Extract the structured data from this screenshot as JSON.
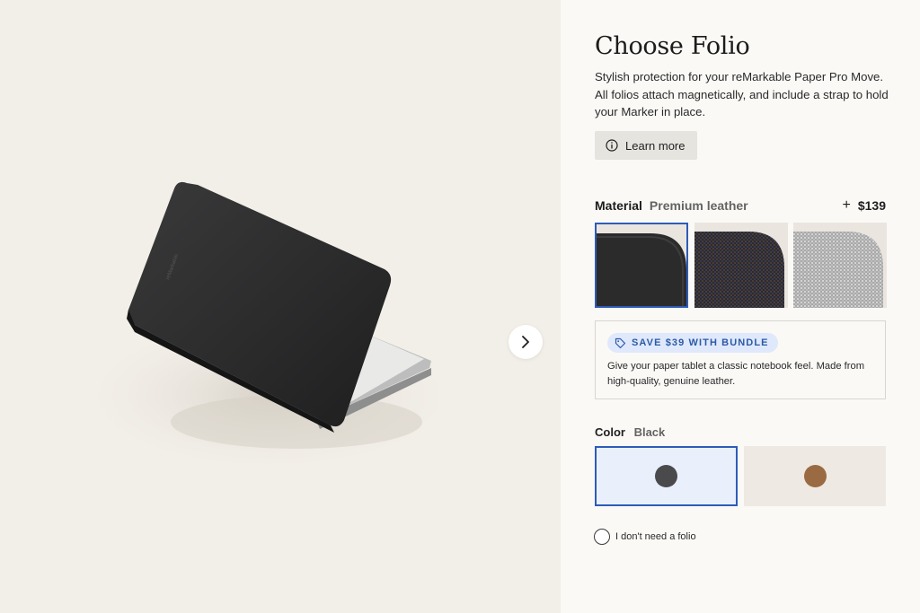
{
  "product": {
    "title": "Choose Folio",
    "description": "Stylish protection for your reMarkable Paper Pro Move. All folios attach magnetically, and include a strap to hold your Marker in place.",
    "learn_more_label": "Learn more"
  },
  "material": {
    "label": "Material",
    "selected": "Premium leather",
    "price_prefix": "+",
    "price": "$139",
    "options": [
      "premium-leather",
      "dark-woven-fabric",
      "light-woven-fabric"
    ]
  },
  "bundle": {
    "badge": "SAVE $39 WITH BUNDLE",
    "text": "Give your paper tablet a classic notebook feel. Made from high-quality, genuine leather."
  },
  "color": {
    "label": "Color",
    "selected": "Black",
    "options": [
      {
        "name": "Black",
        "hex": "#4a4a4c"
      },
      {
        "name": "Brown",
        "hex": "#9a6a42"
      }
    ]
  },
  "no_folio_label": "I don't need a folio",
  "icons": {
    "next": "chevron-right-icon",
    "info": "info-icon",
    "tag": "tag-icon"
  },
  "colors": {
    "accent": "#2e5bb8",
    "badge_bg": "#dfe9fb",
    "panel_bg": "#faf9f6",
    "image_bg": "#f2eee8"
  }
}
